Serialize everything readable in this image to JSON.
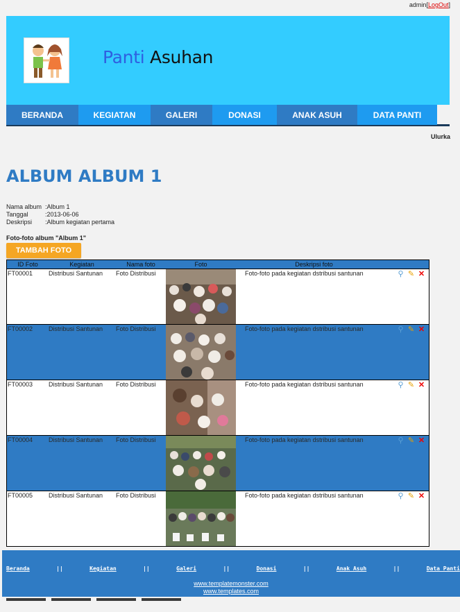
{
  "topbar": {
    "user": "admin",
    "logout": "LogOut"
  },
  "brand": {
    "word1": "Panti",
    "word2": "Asuhan"
  },
  "nav": [
    {
      "label": "BERANDA"
    },
    {
      "label": "KEGIATAN"
    },
    {
      "label": "GALERI"
    },
    {
      "label": "DONASI"
    },
    {
      "label": "ANAK ASUH"
    },
    {
      "label": "DATA PANTI"
    }
  ],
  "marquee": "Ulurka",
  "page_title": "ALBUM ALBUM 1",
  "album": {
    "name_label": "Nama album",
    "name_value": ":Album 1",
    "date_label": "Tanggal",
    "date_value": ":2013-06-06",
    "desc_label": "Deskripsi",
    "desc_value": ":Album kegiatan pertama"
  },
  "photos_heading": "Foto-foto album \"Album 1\"",
  "add_button": "TAMBAH FOTO",
  "table": {
    "headers": [
      "ID Foto",
      "Kegiatan",
      "Nama foto",
      "Foto",
      "Deskripsi foto"
    ],
    "rows": [
      {
        "id": "FT00001",
        "kegiatan": "Distribusi Santunan",
        "nama": "Foto Distribusi",
        "desc": "Foto-foto pada kegiatan dstribusi santunan"
      },
      {
        "id": "FT00002",
        "kegiatan": "Distribusi Santunan",
        "nama": "Foto Distribusi",
        "desc": "Foto-foto pada kegiatan dstribusi santunan"
      },
      {
        "id": "FT00003",
        "kegiatan": "Distribusi Santunan",
        "nama": "Foto Distribusi",
        "desc": "Foto-foto pada kegiatan dstribusi santunan"
      },
      {
        "id": "FT00004",
        "kegiatan": "Distribusi Santunan",
        "nama": "Foto Distribusi",
        "desc": "Foto-foto pada kegiatan dstribusi santunan"
      },
      {
        "id": "FT00005",
        "kegiatan": "Distribusi Santunan",
        "nama": "Foto Distribusi",
        "desc": "Foto-foto pada kegiatan dstribusi santunan"
      }
    ]
  },
  "footer": {
    "links": [
      "Beranda",
      "||",
      "Kegiatan",
      "||",
      "Galeri",
      "||",
      "Donasi",
      "||",
      "Anak Asuh",
      "||",
      "Data Panti"
    ],
    "credit1": "www.templatemonster.com",
    "credit2": "www.templates.com"
  },
  "colors": {
    "header": "#33ccff",
    "nav_dark": "#2f7bc4",
    "nav_light": "#1e9bf0",
    "accent_button": "#f5a623",
    "title": "#2f7bc4"
  },
  "icons": [
    "magnifier-icon",
    "pencil-icon",
    "delete-x-icon"
  ]
}
